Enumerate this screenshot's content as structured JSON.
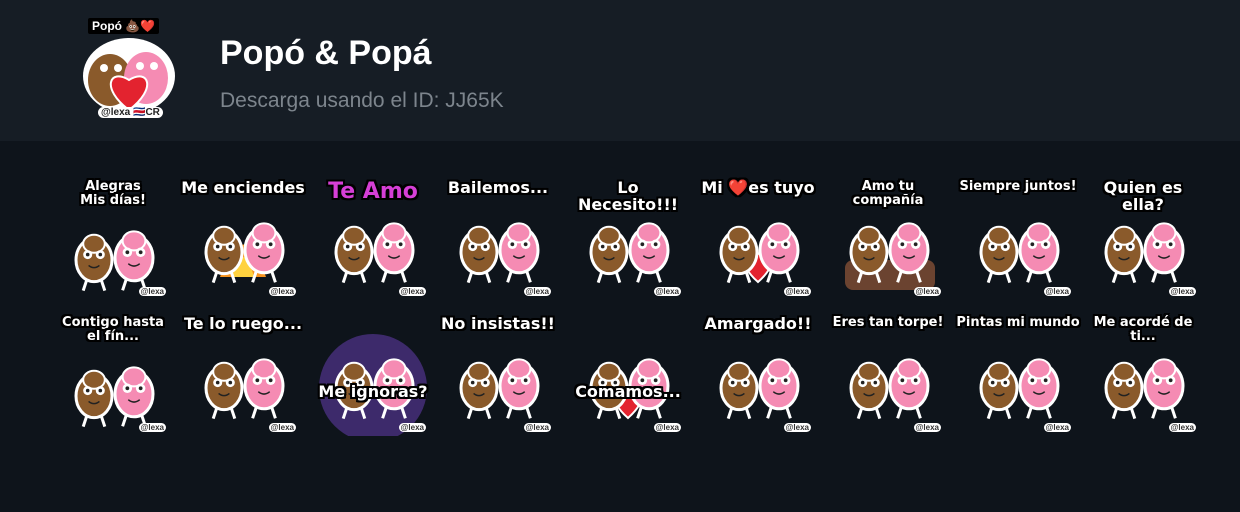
{
  "header": {
    "icon_tag": "Popó 💩❤️",
    "icon_handle": "@lexa 🇨🇷CR",
    "title": "Popó & Popá",
    "subtitle": "Descarga usando el ID: JJ65K"
  },
  "stickers": [
    {
      "caption": "Alegras\nMis días!",
      "scene": "hug"
    },
    {
      "caption": "Me enciendes",
      "scene": "fire"
    },
    {
      "caption": "Te Amo",
      "scene": "kiss"
    },
    {
      "caption": "Bailemos...",
      "scene": "dance"
    },
    {
      "caption": "Lo Necesito!!!",
      "scene": "cuddle"
    },
    {
      "caption": "Mi ❤️es tuyo",
      "scene": "heart"
    },
    {
      "caption": "Amo tu compañía",
      "scene": "sofa"
    },
    {
      "caption": "Siempre juntos!",
      "scene": "highfive"
    },
    {
      "caption": "Quien es ella?",
      "scene": "phone"
    },
    {
      "caption": "Contigo hasta\nel fín...",
      "scene": "walk"
    },
    {
      "caption": "Te lo ruego...",
      "scene": "beg"
    },
    {
      "caption": "Me ignoras?",
      "scene": "bed"
    },
    {
      "caption": "No insistas!!",
      "scene": "push"
    },
    {
      "caption": "Comamos...",
      "scene": "eat"
    },
    {
      "caption": "Amargado!!",
      "scene": "grumpy"
    },
    {
      "caption": "Eres tan torpe!",
      "scene": "clumsy"
    },
    {
      "caption": "Pintas mi mundo",
      "scene": "smile"
    },
    {
      "caption": "Me acordé de ti...",
      "scene": "think"
    }
  ],
  "watermark": "@lexa",
  "colors": {
    "header_bg": "#161d25",
    "body_bg": "#0e141b",
    "pink": "#f58bb3",
    "brown": "#8a5a2b",
    "heart": "#e3232f",
    "caption_accent": "#d63fd6"
  }
}
